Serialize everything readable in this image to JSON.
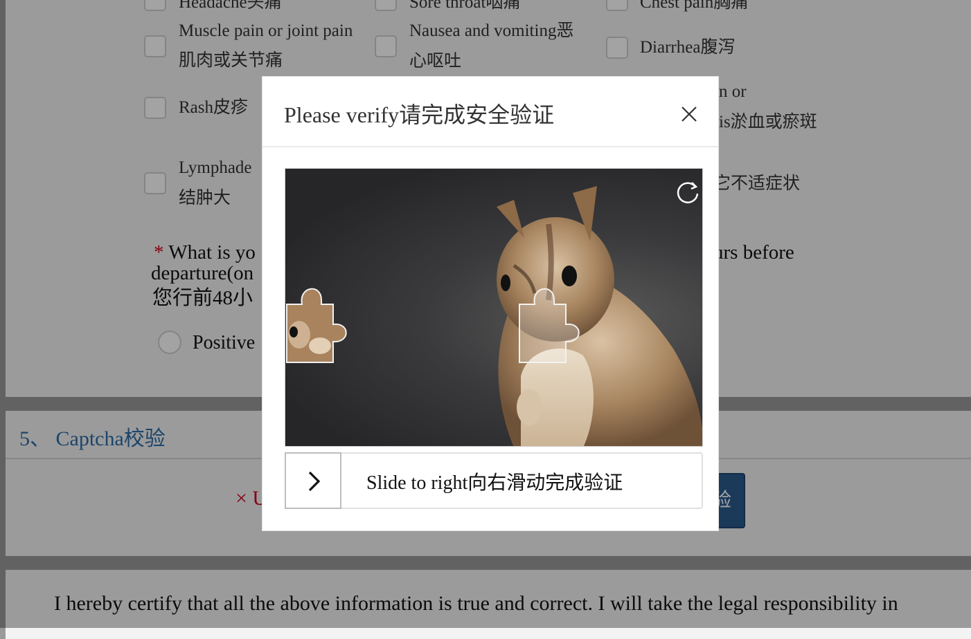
{
  "background": {
    "symptoms": [
      {
        "label_line1": "Headache头痛",
        "label_line2": ""
      },
      {
        "label_line1": "Sore throat咽痛",
        "label_line2": ""
      },
      {
        "label_line1": "Chest pain胸痛",
        "label_line2": ""
      },
      {
        "label_line1": "Muscle pain or joint pain",
        "label_line2": "肌肉或关节痛"
      },
      {
        "label_line1": "Nausea and vomiting恶",
        "label_line2": "心呕吐"
      },
      {
        "label_line1": "Diarrhea腹泻",
        "label_line2": ""
      },
      {
        "label_line1": "Rash皮疹",
        "label_line2": ""
      },
      {
        "label_line1": "n or",
        "label_line2": "is淤血或瘀斑"
      },
      {
        "label_line1": "Lymphade",
        "label_line2": "结肿大"
      },
      {
        "label_line1": "它不适症状",
        "label_line2": ""
      }
    ],
    "question": {
      "required_mark": "*",
      "line1_left": "What is yo",
      "line1_right": "urs before",
      "line2": "departure(on",
      "line3": "您行前48小"
    },
    "radio_option": "Positive",
    "section_title": "5、 Captcha校验",
    "error_text": "× U",
    "verify_button_fragment": "验",
    "certify_text": "I hereby certify that all the above information is true and correct. I will take the legal responsibility in"
  },
  "modal": {
    "title": "Please verify请完成安全验证",
    "close_icon": "close-icon",
    "refresh_icon": "refresh-icon",
    "slider_text": "Slide to right向右滑动完成验证",
    "slider_icon": "chevron-right-icon"
  }
}
